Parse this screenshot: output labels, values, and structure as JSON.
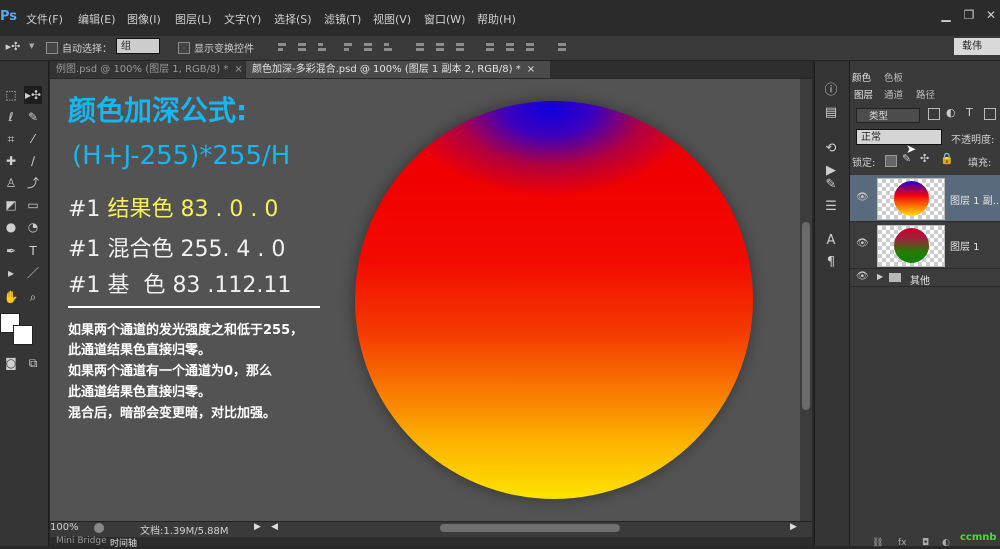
{
  "menubar": {
    "logo": "Ps",
    "items": [
      {
        "label": "文件(F)"
      },
      {
        "label": "编辑(E)"
      },
      {
        "label": "图像(I)"
      },
      {
        "label": "图层(L)"
      },
      {
        "label": "文字(Y)"
      },
      {
        "label": "选择(S)"
      },
      {
        "label": "滤镜(T)"
      },
      {
        "label": "视图(V)"
      },
      {
        "label": "窗口(W)"
      },
      {
        "label": "帮助(H)"
      }
    ]
  },
  "optionsbar": {
    "auto_select_label": "自动选择：",
    "group_value": "组",
    "show_transform_label": "显示变换控件",
    "workspace": "载伟"
  },
  "tabs": [
    {
      "label": "例图.psd @ 100% (图层 1, RGB/8) *",
      "close": "×"
    },
    {
      "label": "颜色加深-多彩混合.psd @ 100% (图层 1 副本 2, RGB/8) *",
      "close": "×"
    }
  ],
  "document": {
    "title": "颜色加深公式:",
    "formula": "(H+J-255)*255/H",
    "rows": [
      {
        "prefix": "#1",
        "label": "结果色",
        "value": "83 . 0 . 0"
      },
      {
        "prefix": "#1",
        "label": "混合色",
        "value": "255. 4 . 0"
      },
      {
        "prefix": "#1",
        "label": "基  色",
        "value": "83 .112.11"
      }
    ],
    "notes": [
      "如果两个通道的发光强度之和低于255，",
      "此通道结果色直接归零。",
      "如果两个通道有一个通道为0，那么",
      "此通道结果色直接归零。",
      "混合后，暗部会变更暗，对比加强。"
    ]
  },
  "statusbar": {
    "zoom": "100%",
    "doc_size": "文档:1.39M/5.88M"
  },
  "bottom_tabs": [
    "Mini Bridge",
    "时间轴"
  ],
  "panels": {
    "color_tab": "颜色",
    "swatch_tab": "色板",
    "layers_tab": "图层",
    "channels_tab": "通道",
    "paths_tab": "路径",
    "kind": "类型",
    "blend_mode": "正常",
    "opacity_label": "不透明度:",
    "lock_label": "锁定:",
    "fill_label": "填充:",
    "layers": [
      {
        "name": "图层 1 副...",
        "selected": true
      },
      {
        "name": "图层 1",
        "selected": false
      }
    ],
    "group": {
      "name": "其他"
    }
  },
  "watermark": "ccmnb",
  "colors": {
    "accent_text": "#19b5ee",
    "highlight_text": "#f5f060",
    "selected_layer": "#5a6a7d"
  }
}
